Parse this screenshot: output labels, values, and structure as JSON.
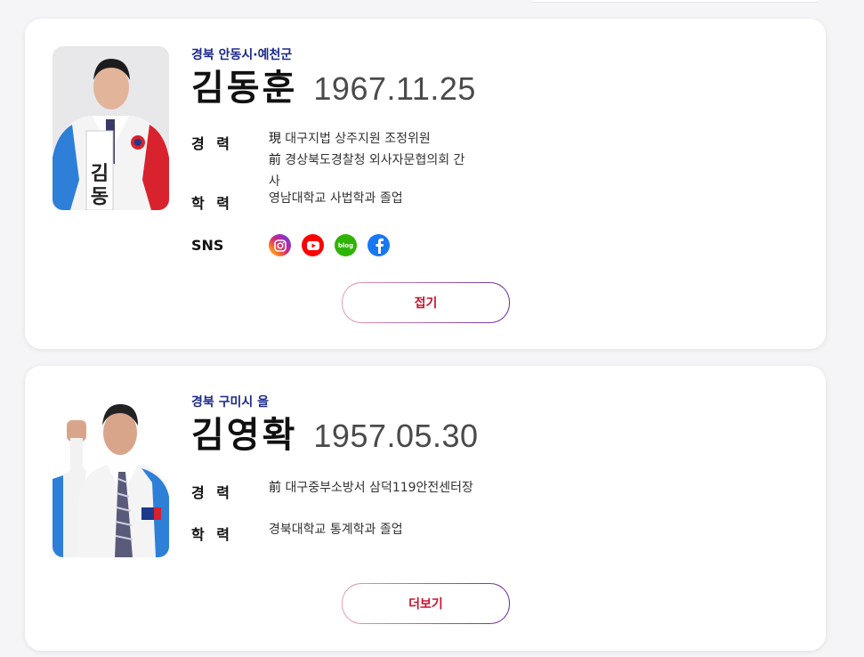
{
  "candidates": [
    {
      "region": "경북 안동시·예천군",
      "name": "김동훈",
      "birth": "1967.11.25",
      "career_label": "경 력",
      "career": [
        {
          "prefix": "現",
          "text": " 대구지법 상주지원 조정위원"
        },
        {
          "prefix": "前",
          "text": " 경상북도경찰청 외사자문협의회 간사"
        }
      ],
      "education_label": "학 력",
      "education": "영남대학교 사법학과 졸업",
      "sns_label": "SNS",
      "sns": [
        "instagram-icon",
        "youtube-icon",
        "blog-icon",
        "facebook-icon"
      ],
      "blog_text": "blog",
      "toggle_label": "접기"
    },
    {
      "region": "경북 구미시 을",
      "name": "김영확",
      "birth": "1957.05.30",
      "career_label": "경 력",
      "career": [
        {
          "prefix": "前",
          "text": " 대구중부소방서 삼덕119안전센터장"
        }
      ],
      "education_label": "학 력",
      "education": "경북대학교 통계학과 졸업",
      "toggle_label": "더보기"
    }
  ],
  "colors": {
    "region": "#1b2a8c",
    "toggle_text": "#c8142c",
    "instagram": "#d62976",
    "youtube": "#ff0000",
    "blog": "#2db400",
    "facebook": "#1877f2"
  }
}
